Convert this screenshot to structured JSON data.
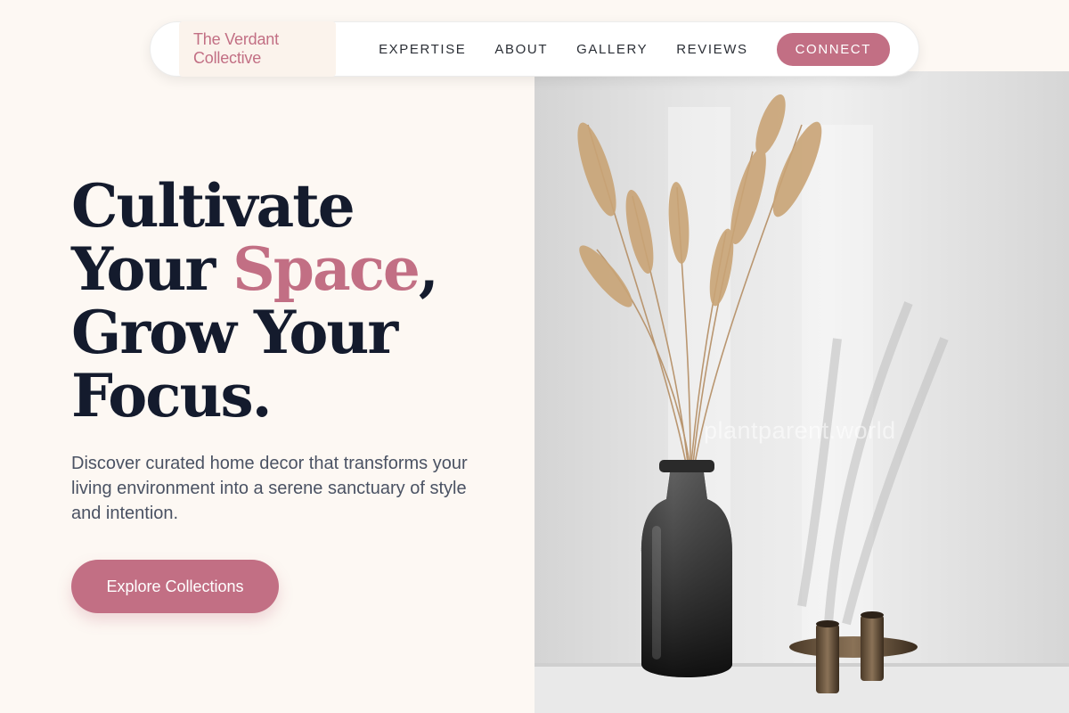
{
  "nav": {
    "brand": "The Verdant Collective",
    "links": [
      {
        "label": "EXPERTISE"
      },
      {
        "label": "ABOUT"
      },
      {
        "label": "GALLERY"
      },
      {
        "label": "REVIEWS"
      }
    ],
    "cta_label": "CONNECT"
  },
  "hero": {
    "headline": {
      "line1": "Cultivate",
      "line2_start": "Your ",
      "line2_accent": "Space",
      "line2_end": ",",
      "line3": "Grow Your",
      "line4": "Focus."
    },
    "subtitle": "Discover curated home decor that transforms your living environment into a serene sanctuary of style and intention.",
    "cta_label": "Explore Collections",
    "image_watermark": "plantparent.world"
  },
  "colors": {
    "accent": "#c26f84",
    "heading": "#141b2d",
    "background": "#fdf8f3"
  },
  "icons": {}
}
